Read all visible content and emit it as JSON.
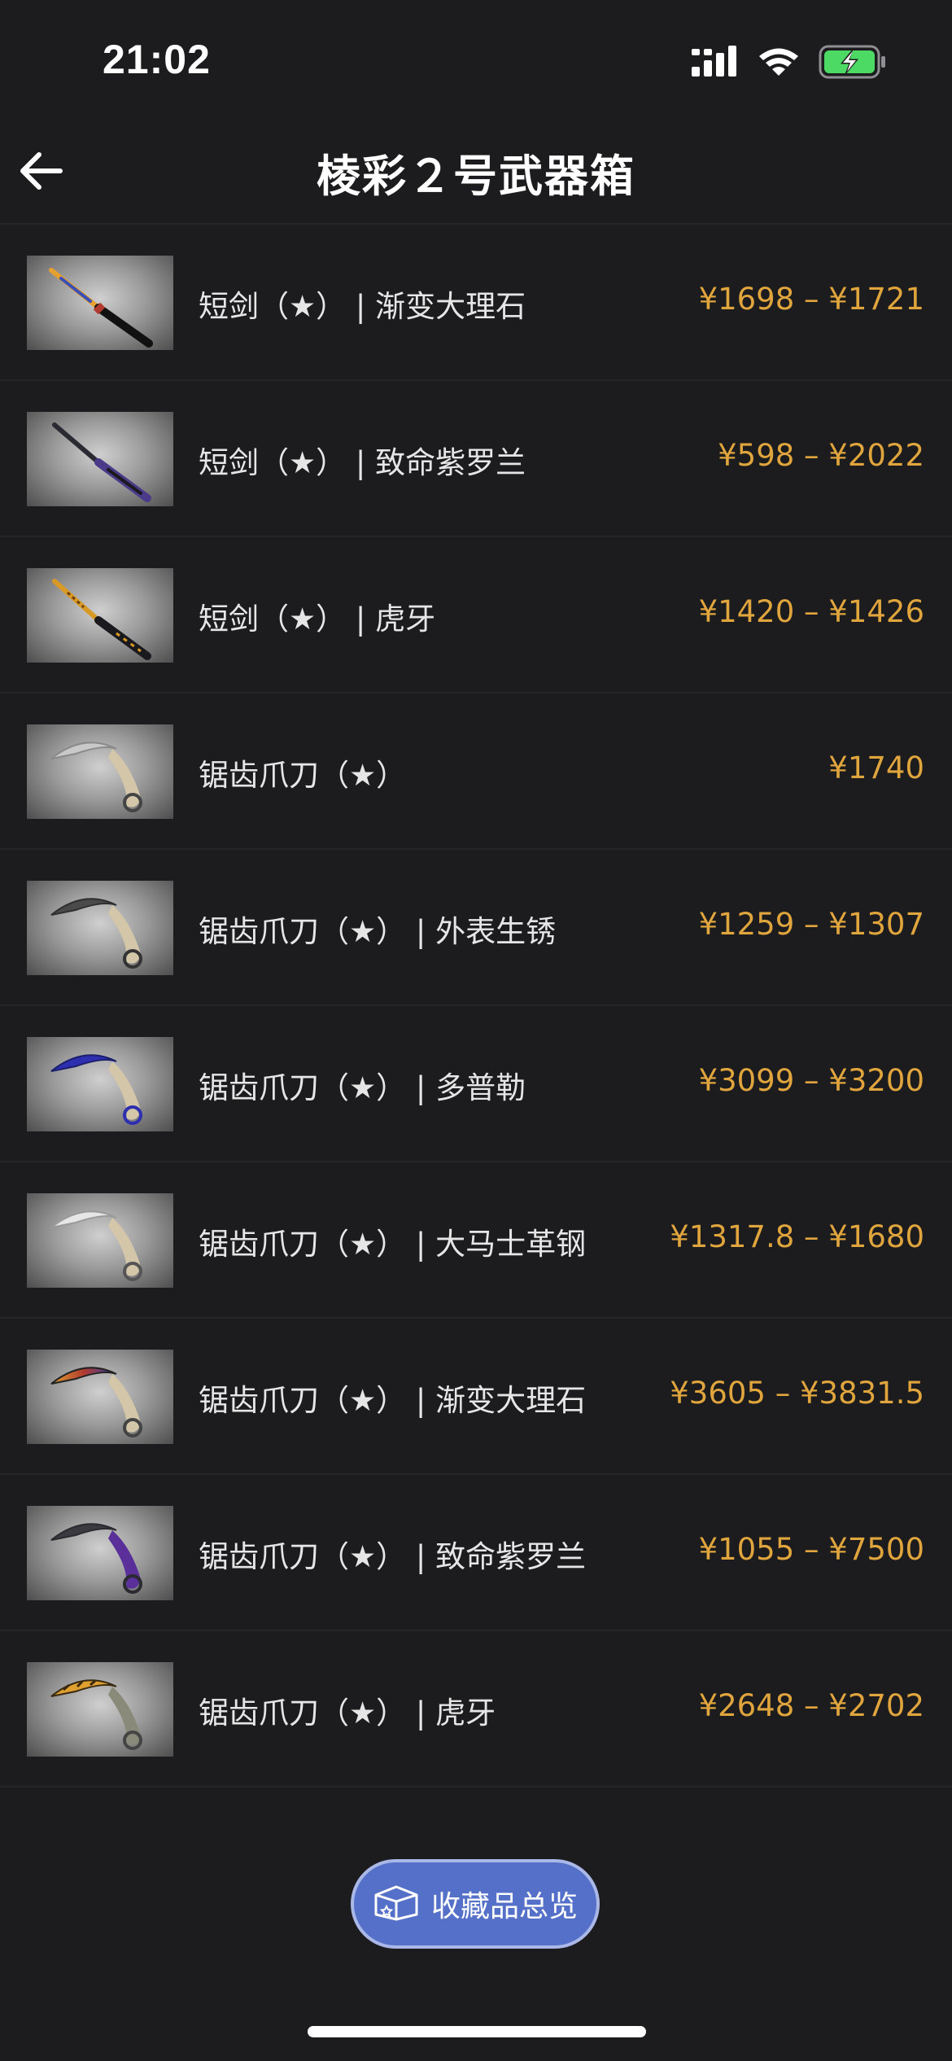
{
  "status_bar": {
    "time": "21:02",
    "icons": [
      "cellular-signal-icon",
      "wifi-icon",
      "battery-charging-icon"
    ]
  },
  "header": {
    "title": "棱彩２号武器箱",
    "back_icon": "arrow-left-icon"
  },
  "items": [
    {
      "name": "短剑（★） | 渐变大理石",
      "price": "¥1698 – ¥1721",
      "icon": "stiletto-knife-marble-fade",
      "colors": [
        "#e5a030",
        "#3a4fb8",
        "#b23a2f"
      ]
    },
    {
      "name": "短剑（★） | 致命紫罗兰",
      "price": "¥598 – ¥2022",
      "icon": "stiletto-knife-ultraviolet",
      "colors": [
        "#2a2a32",
        "#4b3a8a",
        "#1a1a1e"
      ]
    },
    {
      "name": "短剑（★） | 虎牙",
      "price": "¥1420 – ¥1426",
      "icon": "stiletto-knife-tiger-tooth",
      "colors": [
        "#d99a25",
        "#6b3f12",
        "#1a1a1e"
      ]
    },
    {
      "name": "锯齿爪刀（★）",
      "price": "¥1740",
      "icon": "karambit-vanilla",
      "colors": [
        "#c9c9c9",
        "#d4c6a8",
        "#8a8a8a"
      ]
    },
    {
      "name": "锯齿爪刀（★） | 外表生锈",
      "price": "¥1259 – ¥1307",
      "icon": "karambit-rust-coat",
      "colors": [
        "#4a4a4a",
        "#d4c6a8",
        "#2f2f2f"
      ]
    },
    {
      "name": "锯齿爪刀（★） | 多普勒",
      "price": "¥3099 – ¥3200",
      "icon": "karambit-doppler",
      "colors": [
        "#2d2fb0",
        "#d4c6a8",
        "#1b1f6e"
      ]
    },
    {
      "name": "锯齿爪刀（★） | 大马士革钢",
      "price": "¥1317.8 – ¥1680",
      "icon": "karambit-damascus-steel",
      "colors": [
        "#e6e6e6",
        "#d4c6a8",
        "#9a9a9a"
      ]
    },
    {
      "name": "锯齿爪刀（★） | 渐变大理石",
      "price": "¥3605 – ¥3831.5",
      "icon": "karambit-marble-fade",
      "colors": [
        "#e0a030",
        "#2b3fa8",
        "#d4c6a8"
      ]
    },
    {
      "name": "锯齿爪刀（★） | 致命紫罗兰",
      "price": "¥1055 – ¥7500",
      "icon": "karambit-ultraviolet",
      "colors": [
        "#3a3a40",
        "#5a2f9a",
        "#2a2a30"
      ]
    },
    {
      "name": "锯齿爪刀（★） | 虎牙",
      "price": "¥2648 – ¥2702",
      "icon": "karambit-tiger-tooth",
      "colors": [
        "#e0a030",
        "#8a8a7a",
        "#3a2a10"
      ]
    }
  ],
  "collection_button": {
    "label": "收藏品总览",
    "icon": "box-icon"
  },
  "theme": {
    "background": "#1c1c1e",
    "price_color": "#e0a53c",
    "button_color": "#5470c8"
  }
}
